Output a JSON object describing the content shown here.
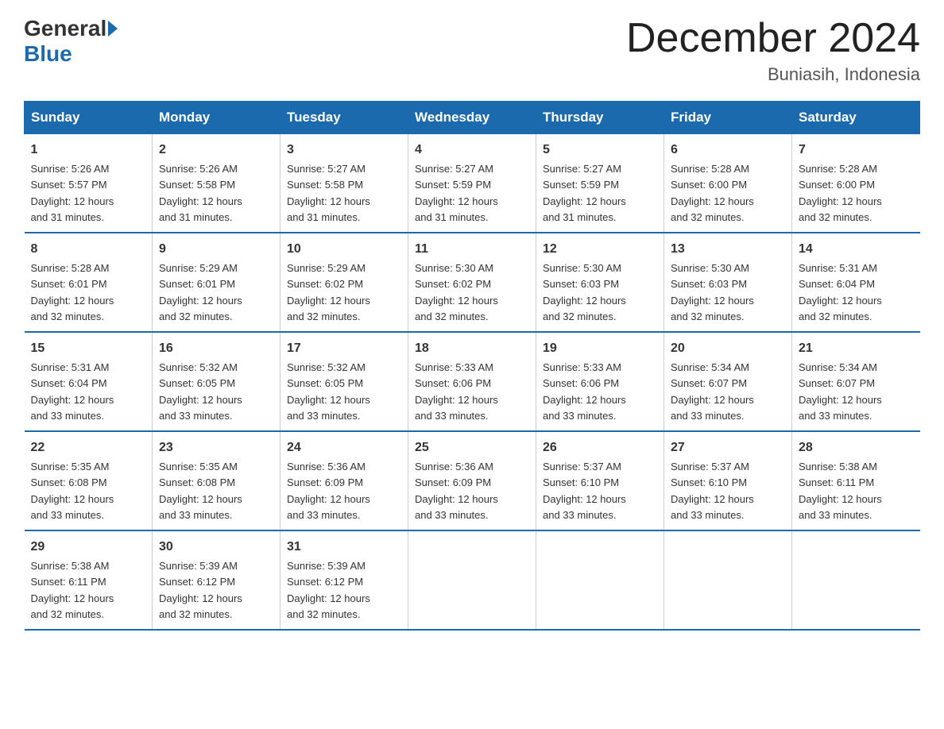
{
  "header": {
    "logo_general": "General",
    "logo_blue": "Blue",
    "month_title": "December 2024",
    "location": "Buniasih, Indonesia"
  },
  "days_of_week": [
    "Sunday",
    "Monday",
    "Tuesday",
    "Wednesday",
    "Thursday",
    "Friday",
    "Saturday"
  ],
  "weeks": [
    [
      {
        "day": "1",
        "sunrise": "5:26 AM",
        "sunset": "5:57 PM",
        "daylight": "12 hours and 31 minutes."
      },
      {
        "day": "2",
        "sunrise": "5:26 AM",
        "sunset": "5:58 PM",
        "daylight": "12 hours and 31 minutes."
      },
      {
        "day": "3",
        "sunrise": "5:27 AM",
        "sunset": "5:58 PM",
        "daylight": "12 hours and 31 minutes."
      },
      {
        "day": "4",
        "sunrise": "5:27 AM",
        "sunset": "5:59 PM",
        "daylight": "12 hours and 31 minutes."
      },
      {
        "day": "5",
        "sunrise": "5:27 AM",
        "sunset": "5:59 PM",
        "daylight": "12 hours and 31 minutes."
      },
      {
        "day": "6",
        "sunrise": "5:28 AM",
        "sunset": "6:00 PM",
        "daylight": "12 hours and 32 minutes."
      },
      {
        "day": "7",
        "sunrise": "5:28 AM",
        "sunset": "6:00 PM",
        "daylight": "12 hours and 32 minutes."
      }
    ],
    [
      {
        "day": "8",
        "sunrise": "5:28 AM",
        "sunset": "6:01 PM",
        "daylight": "12 hours and 32 minutes."
      },
      {
        "day": "9",
        "sunrise": "5:29 AM",
        "sunset": "6:01 PM",
        "daylight": "12 hours and 32 minutes."
      },
      {
        "day": "10",
        "sunrise": "5:29 AM",
        "sunset": "6:02 PM",
        "daylight": "12 hours and 32 minutes."
      },
      {
        "day": "11",
        "sunrise": "5:30 AM",
        "sunset": "6:02 PM",
        "daylight": "12 hours and 32 minutes."
      },
      {
        "day": "12",
        "sunrise": "5:30 AM",
        "sunset": "6:03 PM",
        "daylight": "12 hours and 32 minutes."
      },
      {
        "day": "13",
        "sunrise": "5:30 AM",
        "sunset": "6:03 PM",
        "daylight": "12 hours and 32 minutes."
      },
      {
        "day": "14",
        "sunrise": "5:31 AM",
        "sunset": "6:04 PM",
        "daylight": "12 hours and 32 minutes."
      }
    ],
    [
      {
        "day": "15",
        "sunrise": "5:31 AM",
        "sunset": "6:04 PM",
        "daylight": "12 hours and 33 minutes."
      },
      {
        "day": "16",
        "sunrise": "5:32 AM",
        "sunset": "6:05 PM",
        "daylight": "12 hours and 33 minutes."
      },
      {
        "day": "17",
        "sunrise": "5:32 AM",
        "sunset": "6:05 PM",
        "daylight": "12 hours and 33 minutes."
      },
      {
        "day": "18",
        "sunrise": "5:33 AM",
        "sunset": "6:06 PM",
        "daylight": "12 hours and 33 minutes."
      },
      {
        "day": "19",
        "sunrise": "5:33 AM",
        "sunset": "6:06 PM",
        "daylight": "12 hours and 33 minutes."
      },
      {
        "day": "20",
        "sunrise": "5:34 AM",
        "sunset": "6:07 PM",
        "daylight": "12 hours and 33 minutes."
      },
      {
        "day": "21",
        "sunrise": "5:34 AM",
        "sunset": "6:07 PM",
        "daylight": "12 hours and 33 minutes."
      }
    ],
    [
      {
        "day": "22",
        "sunrise": "5:35 AM",
        "sunset": "6:08 PM",
        "daylight": "12 hours and 33 minutes."
      },
      {
        "day": "23",
        "sunrise": "5:35 AM",
        "sunset": "6:08 PM",
        "daylight": "12 hours and 33 minutes."
      },
      {
        "day": "24",
        "sunrise": "5:36 AM",
        "sunset": "6:09 PM",
        "daylight": "12 hours and 33 minutes."
      },
      {
        "day": "25",
        "sunrise": "5:36 AM",
        "sunset": "6:09 PM",
        "daylight": "12 hours and 33 minutes."
      },
      {
        "day": "26",
        "sunrise": "5:37 AM",
        "sunset": "6:10 PM",
        "daylight": "12 hours and 33 minutes."
      },
      {
        "day": "27",
        "sunrise": "5:37 AM",
        "sunset": "6:10 PM",
        "daylight": "12 hours and 33 minutes."
      },
      {
        "day": "28",
        "sunrise": "5:38 AM",
        "sunset": "6:11 PM",
        "daylight": "12 hours and 33 minutes."
      }
    ],
    [
      {
        "day": "29",
        "sunrise": "5:38 AM",
        "sunset": "6:11 PM",
        "daylight": "12 hours and 32 minutes."
      },
      {
        "day": "30",
        "sunrise": "5:39 AM",
        "sunset": "6:12 PM",
        "daylight": "12 hours and 32 minutes."
      },
      {
        "day": "31",
        "sunrise": "5:39 AM",
        "sunset": "6:12 PM",
        "daylight": "12 hours and 32 minutes."
      },
      null,
      null,
      null,
      null
    ]
  ]
}
